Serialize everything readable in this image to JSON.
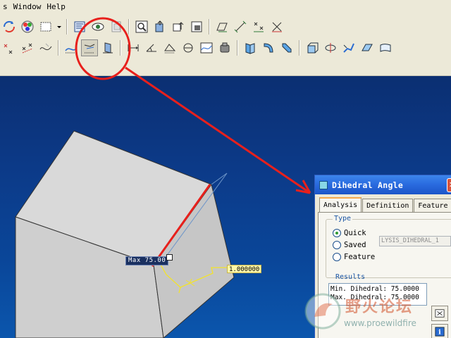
{
  "menu": {
    "items": [
      "s",
      "Window",
      "Help"
    ]
  },
  "toolbar1": {
    "icons": [
      "regenerate-icon",
      "appearance-icon",
      "selection-box-icon",
      "dropdown-arrow-icon",
      "model-tree-icon",
      "view-icon",
      "layers-icon",
      "zoom-icon",
      "export-icon",
      "annotation-icon",
      "snapshot-icon",
      "plane-display-icon",
      "axis-display-icon",
      "point-display-icon",
      "csys-display-icon"
    ]
  },
  "toolbar2": {
    "icons": [
      "datum-point-icon",
      "datum-sketch-icon",
      "dihedral-angle-icon",
      "curvature-icon",
      "measure-distance-icon",
      "measure-angle-icon",
      "measure-area-icon",
      "measure-diameter-icon",
      "measure-curve-icon",
      "mass-properties-icon",
      "draft-icon",
      "round-icon",
      "chamfer-icon",
      "extrude-icon",
      "revolve-icon",
      "sweep-icon",
      "blend-icon",
      "surface-icon"
    ]
  },
  "viewport": {
    "max_label": "Max 75.00",
    "dimension_value": "1.000000"
  },
  "dialog": {
    "title": "Dihedral Angle",
    "tabs": [
      "Analysis",
      "Definition",
      "Feature"
    ],
    "type_label": "Type",
    "type_options": [
      "Quick",
      "Saved",
      "Feature"
    ],
    "selected_type": "Quick",
    "saved_name": "LYSIS_DIHEDRAL_1",
    "results_label": "Results",
    "results": [
      "Min. Dihedral: 75.0000",
      "Max. Dihedral: 75.0000"
    ]
  },
  "watermark": {
    "title": "野火论坛",
    "url": "www.proewildfire"
  },
  "colors": {
    "annotation_red": "#e8201c",
    "dimension_yellow": "#f3e32a",
    "viewport_top": "#0b2f72",
    "viewport_bottom": "#0b56ad",
    "dialog_title": "#2a6ce0"
  }
}
